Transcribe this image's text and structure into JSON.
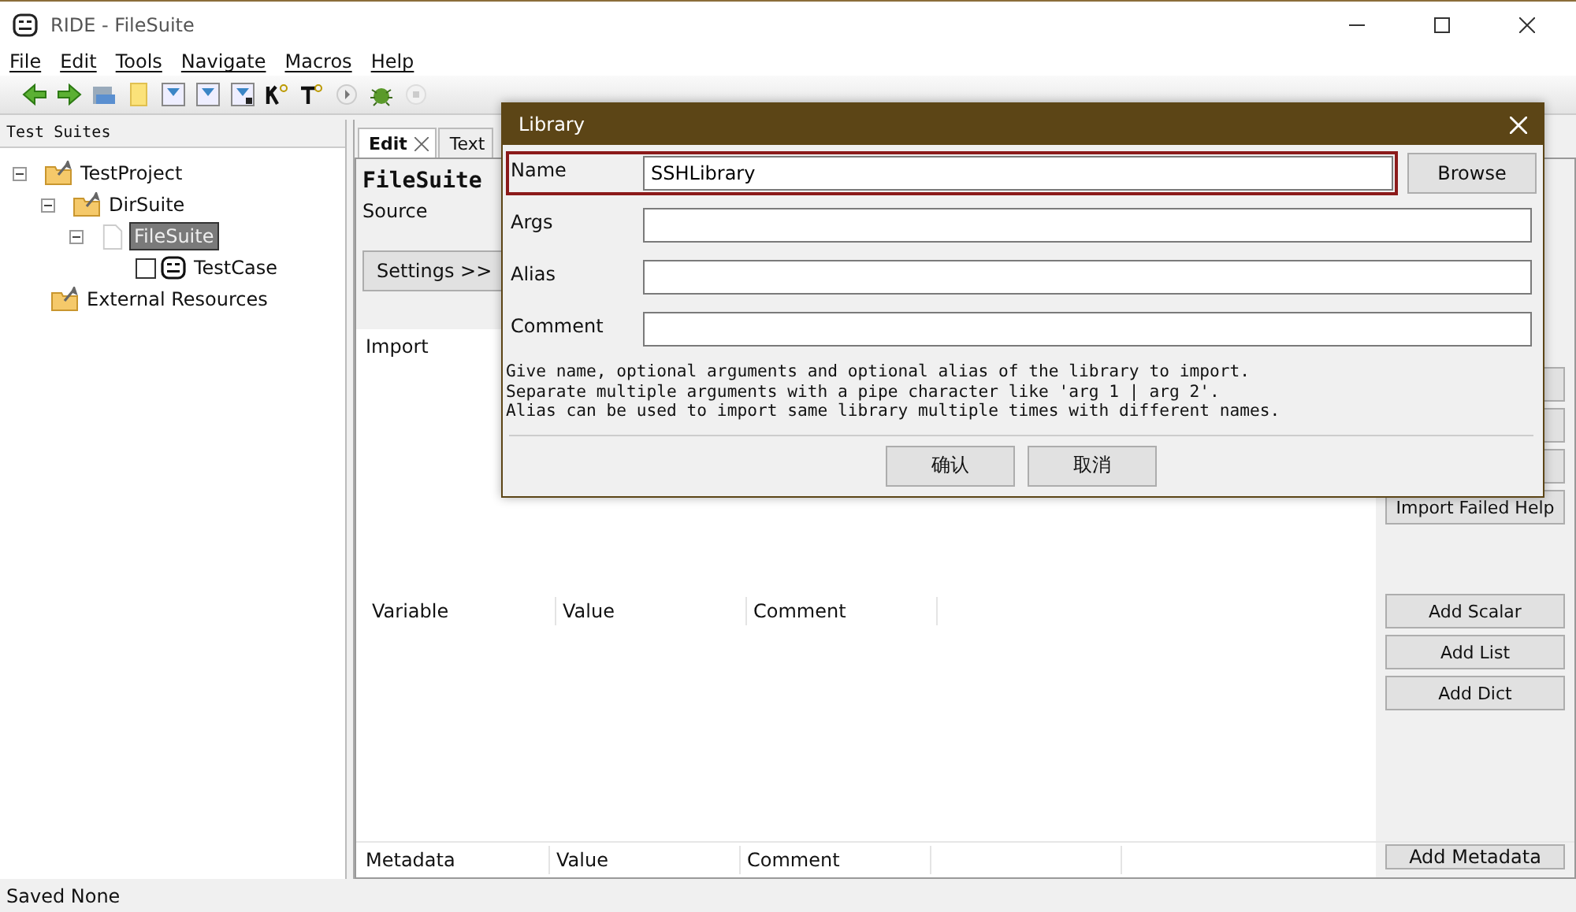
{
  "window": {
    "title": "RIDE - FileSuite"
  },
  "menu": [
    {
      "label": "File"
    },
    {
      "label": "Edit"
    },
    {
      "label": "Tools"
    },
    {
      "label": "Navigate"
    },
    {
      "label": "Macros"
    },
    {
      "label": "Help"
    }
  ],
  "tree": {
    "title": "Test Suites",
    "items": [
      {
        "label": "TestProject",
        "kind": "suite",
        "selected": false,
        "expanded": true,
        "children": [
          {
            "label": "DirSuite",
            "kind": "suite",
            "selected": false,
            "expanded": true,
            "children": [
              {
                "label": "FileSuite",
                "kind": "file",
                "selected": true,
                "expanded": true,
                "children": [
                  {
                    "label": "TestCase",
                    "kind": "test",
                    "selected": false,
                    "checked": false
                  }
                ]
              }
            ]
          }
        ]
      },
      {
        "label": "External Resources",
        "kind": "suite",
        "selected": false
      }
    ]
  },
  "tabs": [
    {
      "label": "Edit",
      "selected": true,
      "closable": true
    },
    {
      "label": "Text",
      "selected": false,
      "closable": false
    }
  ],
  "editor": {
    "name": "FileSuite",
    "source_label": "Source",
    "settings_button": "Settings >>",
    "import_label": "Import",
    "import_buttons": [
      {
        "kind": "covered"
      },
      {
        "kind": "covered"
      },
      {
        "kind": "covered"
      },
      {
        "kind": "button",
        "label": "Import Failed Help"
      }
    ],
    "variable_columns": [
      "Variable",
      "Value",
      "Comment"
    ],
    "variable_buttons": [
      "Add Scalar",
      "Add List",
      "Add Dict"
    ],
    "metadata_columns": [
      "Metadata",
      "Value",
      "Comment"
    ],
    "metadata_button": "Add Metadata"
  },
  "dialog": {
    "title": "Library",
    "fields": [
      {
        "label": "Name",
        "value": "SSHLibrary",
        "focused": true,
        "browse": "Browse"
      },
      {
        "label": "Args",
        "focused": false
      },
      {
        "label": "Alias",
        "focused": false
      },
      {
        "label": "Comment",
        "focused": false
      }
    ],
    "help": "Give name, optional arguments and optional alias of the library to import.\nSeparate multiple arguments with a pipe character like 'arg 1 | arg 2'.\nAlias can be used to import same library multiple times with different names.",
    "buttons": [
      "确认",
      "取消"
    ]
  },
  "status_bar": "Saved None"
}
